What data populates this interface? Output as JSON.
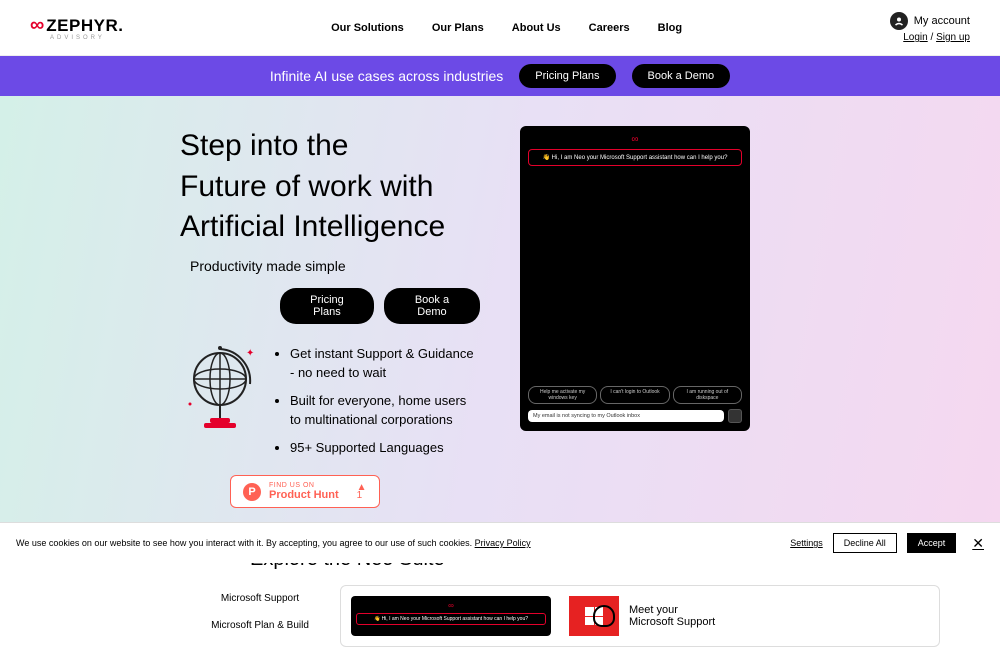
{
  "header": {
    "logo_symbol": "∞",
    "logo_text": "ZEPHYR.",
    "logo_sub": "ADVISORY",
    "nav": [
      "Our Solutions",
      "Our Plans",
      "About Us",
      "Careers",
      "Blog"
    ],
    "my_account": "My account",
    "login": "Login",
    "signup": "Sign up"
  },
  "banner": {
    "text": "Infinite AI use cases across industries",
    "pricing": "Pricing Plans",
    "demo": "Book a Demo"
  },
  "hero": {
    "h1_l1": "Step into the",
    "h1_l2": "Future of work with",
    "h1_l3": "Artificial Intelligence",
    "subtitle": "Productivity made simple",
    "pricing": "Pricing Plans",
    "demo": "Book a Demo",
    "bullets": [
      "Get instant Support & Guidance - no need to wait",
      "Built for everyone, home users to multinational corporations",
      "95+ Supported Languages"
    ],
    "ph_find": "FIND US ON",
    "ph_name": "Product Hunt",
    "ph_count": "1"
  },
  "chat": {
    "welcome": "👋 Hi, I am Neo your Microsoft Support assistant how can I help you?",
    "chips": [
      "Help me activate my windows key",
      "I can't login to Outlook",
      "I am running out of diskspace"
    ],
    "input": "My email is not syncing to my Outlook inbox"
  },
  "explore": {
    "title": "Explore the Neo Suite",
    "tabs": [
      "Microsoft Support",
      "Microsoft Plan & Build"
    ],
    "mini_welcome": "👋 Hi, I am Neo your Microsoft Support assistant how can I help you?",
    "ms_l1": "Meet your",
    "ms_l2": "Microsoft Support"
  },
  "cookie": {
    "text": "We use cookies on our website to see how you interact with it. By accepting, you agree to our use of such cookies.",
    "privacy": "Privacy Policy",
    "settings": "Settings",
    "decline": "Decline All",
    "accept": "Accept"
  }
}
